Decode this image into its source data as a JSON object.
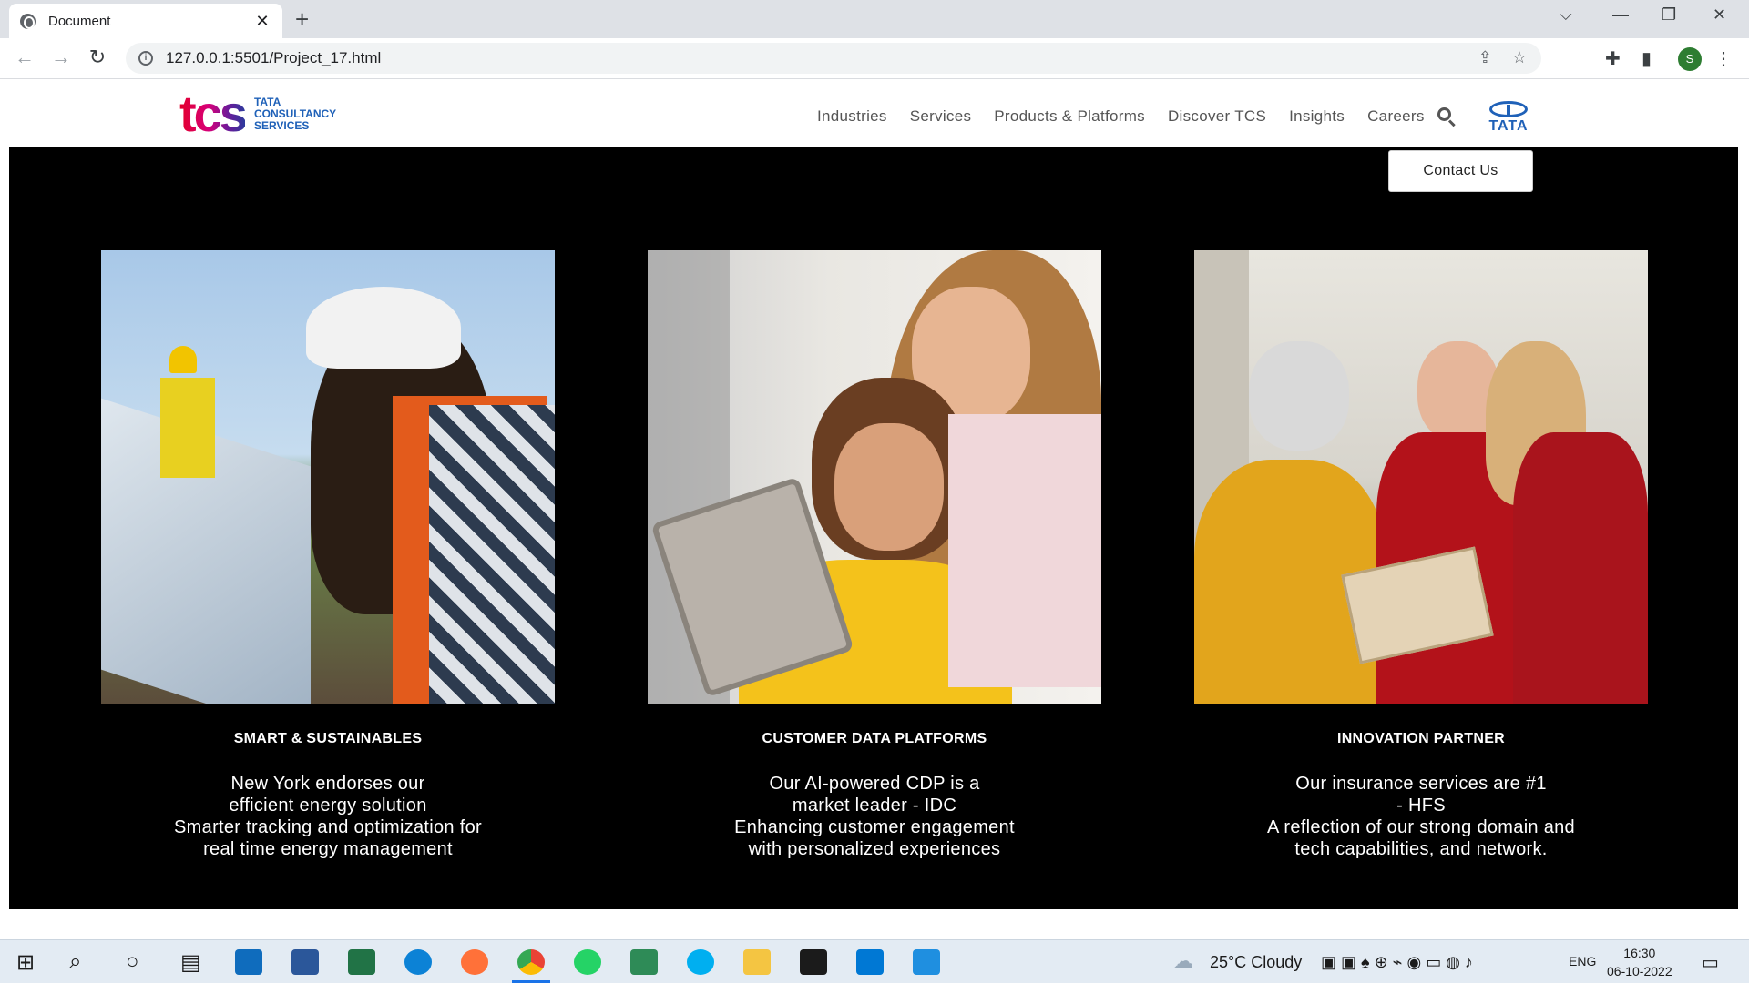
{
  "browser": {
    "tab_title": "Document",
    "tab_close": "✕",
    "new_tab": "+",
    "url": "127.0.0.1:5501/Project_17.html",
    "profile_initial": "S"
  },
  "site": {
    "logo_text": "tcs",
    "logo_sub_line1": "TATA",
    "logo_sub_line2": "CONSULTANCY",
    "logo_sub_line3": "SERVICES",
    "nav": [
      "Industries",
      "Services",
      "Products & Platforms",
      "Discover TCS",
      "Insights",
      "Careers"
    ],
    "tata_word": "TATA",
    "contact_button": "Contact Us"
  },
  "cards": [
    {
      "heading": "SMART & SUSTAINABLES",
      "lines": [
        "New York endorses our",
        "efficient energy solution",
        "Smarter tracking and optimization for",
        "real time energy management"
      ]
    },
    {
      "heading": "CUSTOMER DATA PLATFORMS",
      "lines": [
        "Our AI-powered CDP is a",
        "market leader - IDC",
        "Enhancing customer engagement",
        "with personalized experiences"
      ]
    },
    {
      "heading": "INNOVATION PARTNER",
      "lines": [
        "Our insurance services are #1",
        "- HFS",
        "A reflection of our strong domain and",
        "tech capabilities, and network."
      ]
    }
  ],
  "taskbar": {
    "weather": "25°C  Cloudy",
    "language": "ENG",
    "time": "16:30",
    "date": "06-10-2022"
  },
  "colors": {
    "main_bg": "#000000",
    "brand_blue": "#1f61b8",
    "taskbar_bg": "#e3ebf3"
  }
}
